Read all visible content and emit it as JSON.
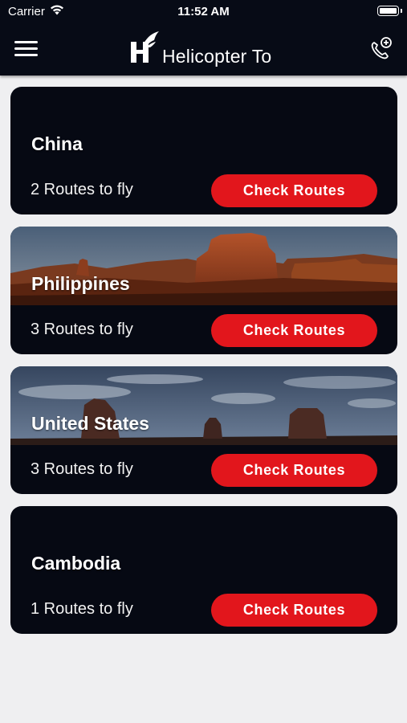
{
  "status_bar": {
    "carrier": "Carrier",
    "time": "11:52 AM"
  },
  "header": {
    "title": "Helicopter To",
    "menu_icon": "hamburger-menu-icon",
    "logo_icon": "winged-h-logo",
    "call_icon": "phone-add-icon"
  },
  "colors": {
    "header_bg": "#070b16",
    "card_bg": "#060913",
    "accent": "#e2161c",
    "page_bg": "#efeff1"
  },
  "destinations": [
    {
      "country": "China",
      "routes": "2 Routes to fly",
      "button": "Check Routes",
      "banner": "none"
    },
    {
      "country": "Philippines",
      "routes": "3 Routes to fly",
      "button": "Check Routes",
      "banner": "desert-butte-image"
    },
    {
      "country": "United States",
      "routes": "3 Routes to fly",
      "button": "Check Routes",
      "banner": "monument-valley-image"
    },
    {
      "country": "Cambodia",
      "routes": "1 Routes to fly",
      "button": "Check Routes",
      "banner": "none"
    }
  ]
}
